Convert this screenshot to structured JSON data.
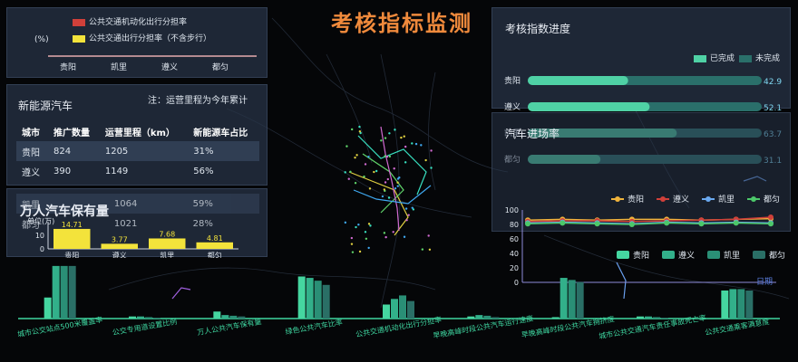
{
  "page_title": "考核指标监测",
  "top_left_panel": {
    "unit": "(%)",
    "legend": [
      {
        "label": "公共交通机动化出行分担率",
        "color": "#d0403a"
      },
      {
        "label": "公共交通出行分担率（不含步行）",
        "color": "#f3e33b"
      }
    ],
    "cities": [
      "贵阳",
      "凯里",
      "遵义",
      "都匀"
    ]
  },
  "nev_panel": {
    "title": "新能源汽车",
    "note": "注：运营里程为今年累计",
    "headers": [
      "城市",
      "推广数量",
      "运营里程（km）",
      "新能源车占比"
    ],
    "rows": [
      [
        "贵阳",
        "824",
        "1205",
        "31%"
      ],
      [
        "遵义",
        "390",
        "1149",
        "56%"
      ],
      [
        "凯里",
        "",
        "1064",
        "59%"
      ],
      [
        "都匀",
        "",
        "1021",
        "28%"
      ]
    ]
  },
  "vehicle_panel": {
    "title": "万人汽车保有量",
    "unit": "单位(万)",
    "y_ticks": [
      "10",
      "0"
    ],
    "chart_data": {
      "type": "bar",
      "categories": [
        "贵阳",
        "遵义",
        "凯里",
        "都匀"
      ],
      "values": [
        14.71,
        3.77,
        7.68,
        4.81
      ],
      "value_labels": [
        "14.71",
        "3.77",
        "7.68",
        "4.81"
      ],
      "ylim": [
        0,
        20
      ],
      "color": "#f3e33b"
    }
  },
  "progress_panel": {
    "title": "考核指数进度",
    "legend": [
      {
        "label": "已完成",
        "color": "#4fd1a5"
      },
      {
        "label": "未完成",
        "color": "#2a6f6a"
      }
    ],
    "chart_data": {
      "type": "bar",
      "categories": [
        "贵阳",
        "遵义",
        "凯里",
        "都匀"
      ],
      "values": [
        42.9,
        52.1,
        63.7,
        31.1
      ],
      "value_labels": [
        "42.9",
        "52.1",
        "63.7",
        "31.1"
      ],
      "xlim": [
        0,
        100
      ]
    }
  },
  "rate_panel": {
    "title": "汽车进场率",
    "legend": [
      {
        "label": "贵阳",
        "color": "#f0b43c"
      },
      {
        "label": "遵义",
        "color": "#d0403a"
      },
      {
        "label": "凯里",
        "color": "#6aa9f0"
      },
      {
        "label": "都匀",
        "color": "#4cc86a"
      }
    ],
    "y_ticks": [
      "100",
      "80",
      "60",
      "40",
      "20",
      "0"
    ],
    "chart_data": {
      "type": "line",
      "x": [
        1,
        2,
        3,
        4,
        5,
        6,
        7,
        8
      ],
      "ylim": [
        0,
        100
      ],
      "series": [
        {
          "name": "贵阳",
          "values": [
            86,
            87,
            86,
            87,
            87,
            86,
            87,
            88
          ]
        },
        {
          "name": "遵义",
          "values": [
            84,
            85,
            85,
            84,
            85,
            86,
            87,
            90
          ]
        },
        {
          "name": "凯里",
          "values": [
            82,
            83,
            82,
            81,
            83,
            82,
            83,
            82
          ]
        },
        {
          "name": "都匀",
          "values": [
            81,
            82,
            81,
            80,
            82,
            81,
            82,
            81
          ]
        }
      ]
    }
  },
  "bottom_chart": {
    "legend": [
      {
        "label": "贵阳",
        "color": "#45d6a0"
      },
      {
        "label": "遵义",
        "color": "#32b08a"
      },
      {
        "label": "凯里",
        "color": "#2a8f76"
      },
      {
        "label": "都匀",
        "color": "#2a6f66"
      }
    ],
    "colors": [
      "#45d6a0",
      "#32b08a",
      "#2a8f76",
      "#2a6f66"
    ],
    "right_label": "日期",
    "chart_data": {
      "type": "bar",
      "categories": [
        "城市公交站点500米覆盖率",
        "公交专用道设置比例",
        "万人公共汽车保有量",
        "绿色公共汽车比率",
        "公共交通机动化出行分担率",
        "早晚高峰时段公共汽车运行速度",
        "早晚高峰时段公共汽车拥挤度",
        "城市公共交通汽车责任事故死亡率",
        "公共交通乘客满意度"
      ],
      "series": [
        {
          "name": "贵阳",
          "values": [
            30,
            3,
            10,
            60,
            20,
            3,
            2,
            3,
            40
          ]
        },
        {
          "name": "遵义",
          "values": [
            75,
            3,
            5,
            58,
            28,
            5,
            58,
            3,
            42
          ]
        },
        {
          "name": "凯里",
          "values": [
            75,
            2,
            4,
            54,
            33,
            4,
            55,
            2,
            42
          ]
        },
        {
          "name": "都匀",
          "values": [
            75,
            1,
            3,
            48,
            25,
            2,
            52,
            1,
            40
          ]
        }
      ],
      "ylim": [
        0,
        80
      ]
    }
  }
}
